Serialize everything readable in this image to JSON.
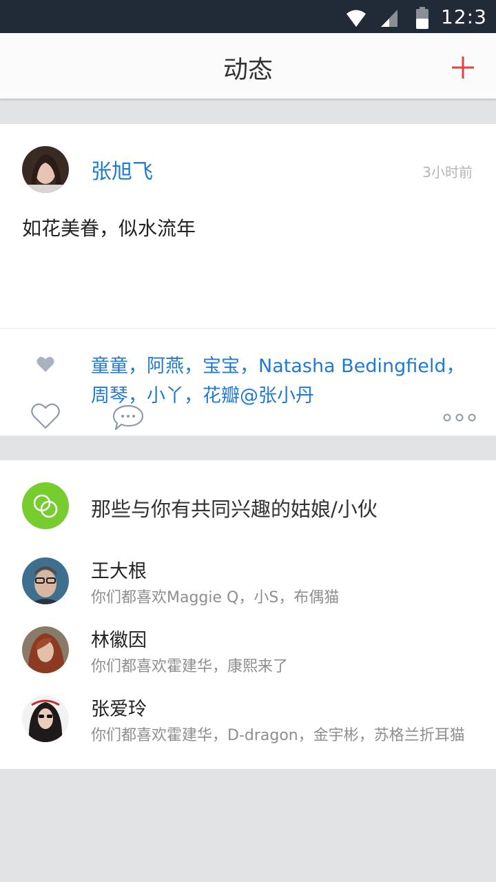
{
  "status_bar": {
    "time": "12:3"
  },
  "header": {
    "title": "动态"
  },
  "post": {
    "author": "张旭飞",
    "time_ago": "3小时前",
    "content": "如花美眷，似水流年",
    "likers": "童童，阿燕，宝宝，Natasha Bedingfield，周琴，小丫，花瓣@张小丹"
  },
  "recommend": {
    "title": "那些与你有共同兴趣的姑娘/小伙",
    "items": [
      {
        "name": "王大根",
        "interest": "你们都喜欢Maggie Q，小S，布偶猫"
      },
      {
        "name": "林徽因",
        "interest": "你们都喜欢霍建华，康熙来了"
      },
      {
        "name": "张爱玲",
        "interest": "你们都喜欢霍建华，D-dragon，金宇彬，苏格兰折耳猫"
      }
    ]
  },
  "colors": {
    "accent": "#1f7ad0",
    "brand_red": "#e8403b",
    "green": "#77cc2e",
    "status_bar": "#212a37"
  }
}
